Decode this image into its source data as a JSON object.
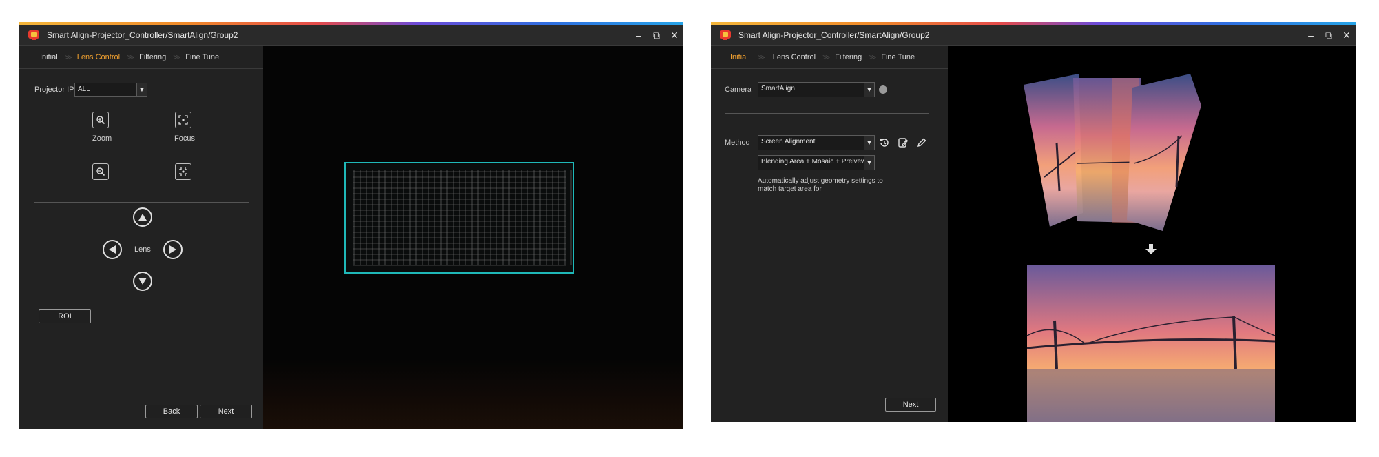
{
  "left_window": {
    "title": "Smart Align-Projector_Controller/SmartAlign/Group2",
    "controls": {
      "minimize": "–",
      "restore": "⧉",
      "close": "✕"
    },
    "steps": [
      {
        "label": "Initial",
        "active": false
      },
      {
        "label": "Lens Control",
        "active": true
      },
      {
        "label": "Filtering",
        "active": false
      },
      {
        "label": "Fine Tune",
        "active": false
      }
    ],
    "projector_ip": {
      "label": "Projector IP",
      "value": "ALL"
    },
    "zoom_label": "Zoom",
    "focus_label": "Focus",
    "lens_label": "Lens",
    "roi_button": "ROI",
    "back_button": "Back",
    "next_button": "Next",
    "accent_color": "#f0a030",
    "grid_frame_color": "#1fb8b8"
  },
  "right_window": {
    "title": "Smart Align-Projector_Controller/SmartAlign/Group2",
    "controls": {
      "minimize": "–",
      "restore": "⧉",
      "close": "✕"
    },
    "steps": [
      {
        "label": "Initial",
        "active": true
      },
      {
        "label": "Lens Control",
        "active": false
      },
      {
        "label": "Filtering",
        "active": false
      },
      {
        "label": "Fine Tune",
        "active": false
      }
    ],
    "camera": {
      "label": "Camera",
      "value": "SmartAlign"
    },
    "method": {
      "label": "Method",
      "value": "Screen Alignment"
    },
    "blending": {
      "value": "Blending Area + Mosaic + Preivew"
    },
    "description": "Automatically adjust geometry settings to match target area for",
    "next_button": "Next",
    "icons": [
      "reset-icon",
      "edit-document-icon",
      "pencil-icon",
      "down-arrow-icon"
    ]
  }
}
